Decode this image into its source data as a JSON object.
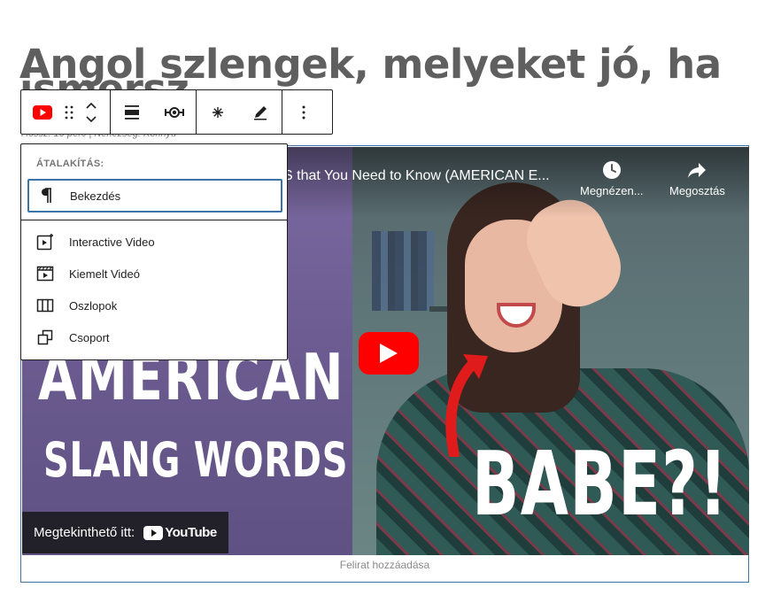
{
  "post": {
    "title_line1": "Angol szlengek, melyeket jó, ha",
    "title_line2": "ismersz",
    "meta": "Hossz: 10 perc  |  Nehézség: Könnyű"
  },
  "toolbar": {
    "block_icon": "youtube-icon",
    "drag_icon": "drag-handle-icon",
    "move_up_icon": "chevron-up-icon",
    "move_down_icon": "chevron-down-icon",
    "align_icon": "align-center-icon",
    "embed_icon": "embed-icon",
    "sparkle_icon": "sparkle-icon",
    "edit_icon": "pencil-icon",
    "more_icon": "more-vertical-icon"
  },
  "transform_menu": {
    "heading": "ÁTALAKÍTÁS:",
    "items": [
      {
        "label": "Bekezdés",
        "icon": "paragraph-icon"
      },
      {
        "label": "Interactive Video",
        "icon": "interactive-video-icon"
      },
      {
        "label": "Kiemelt Videó",
        "icon": "featured-video-icon"
      },
      {
        "label": "Oszlopok",
        "icon": "columns-icon"
      },
      {
        "label": "Csoport",
        "icon": "group-icon"
      }
    ]
  },
  "video": {
    "title": "S that You Need to Know (AMERICAN E...",
    "watch_later": "Megnézen...",
    "share": "Megosztás",
    "overlay_line1": "AMERICAN",
    "overlay_line2": "SLANG WORDS",
    "overlay_line3": "BABE?!",
    "watch_on": "Megtekinthető itt:",
    "youtube": "YouTube",
    "colors": {
      "play": "#ff0000",
      "selection": "#3a74a9"
    }
  },
  "caption": {
    "placeholder": "Felirat hozzáadása"
  }
}
